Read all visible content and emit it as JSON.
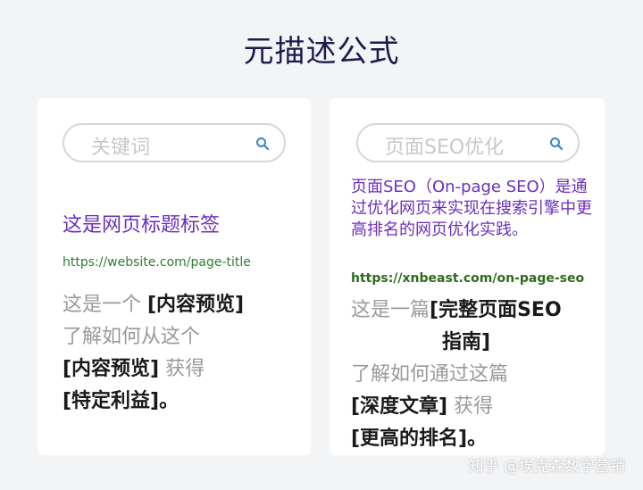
{
  "page": {
    "title": "元描述公式"
  },
  "left_card": {
    "search_placeholder": "关键词",
    "serp_title": "这是网页标题标签",
    "serp_url": "https://website.com/page-title",
    "desc": {
      "l1_plain": "这是一个 ",
      "l1_bold": "[内容预览]",
      "l2_plain": "了解如何从这个",
      "l3_bold": "[内容预览]",
      "l3_plain": " 获得",
      "l4_bold": "[特定利益]",
      "l4_end": "。"
    }
  },
  "right_card": {
    "search_placeholder": "页面SEO优化",
    "serp_title": "页面SEO（On-page SEO）是通过优化网页来实现在搜索引擎中更高排名的网页优化实践。",
    "serp_url": "https://xnbeast.com/on-page-seo",
    "desc": {
      "l1_plain": "这是一篇",
      "l1_bold": "[完整页面SEO",
      "l2_bold": "指南]",
      "l3_plain": "了解如何通过这篇",
      "l4_bold": "[深度文章]",
      "l4_plain": " 获得",
      "l5_bold": "[更高的排名]",
      "l5_end": "。"
    }
  },
  "watermark": "知乎 @埃克森数字营销",
  "colors": {
    "title": "#1e1a4d",
    "serp_title": "#6b2fbf",
    "url_green": "#2e7d32",
    "search_icon": "#3b82c4"
  }
}
